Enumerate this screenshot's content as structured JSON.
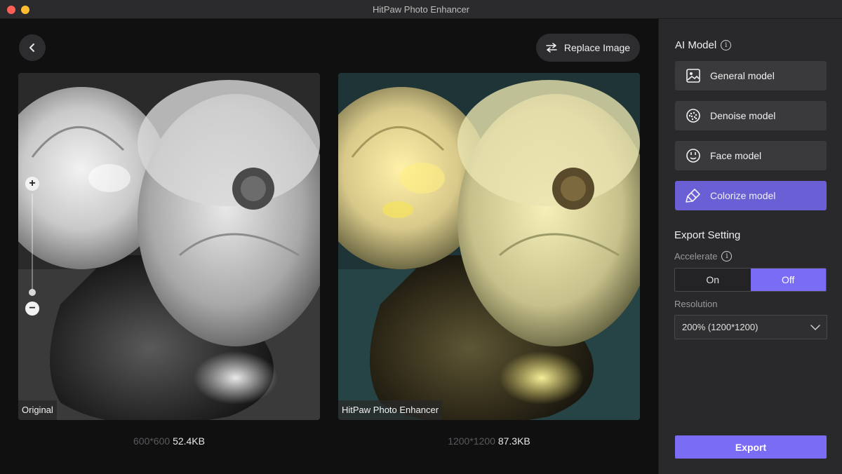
{
  "window": {
    "title": "HitPaw Photo Enhancer"
  },
  "toolbar": {
    "replace_label": "Replace Image"
  },
  "preview": {
    "original": {
      "label": "Original",
      "dimensions": "600*600",
      "size": "52.4KB"
    },
    "enhanced": {
      "label": "HitPaw Photo Enhancer",
      "dimensions": "1200*1200",
      "size": "87.3KB"
    },
    "zoom": {
      "plus": "+",
      "minus": "−"
    }
  },
  "sidebar": {
    "ai_model_title": "AI Model",
    "models": [
      {
        "label": "General model",
        "icon": "image-icon",
        "active": false
      },
      {
        "label": "Denoise model",
        "icon": "denoise-icon",
        "active": false
      },
      {
        "label": "Face model",
        "icon": "face-icon",
        "active": false
      },
      {
        "label": "Colorize model",
        "icon": "colorize-icon",
        "active": true
      }
    ],
    "export_setting_title": "Export Setting",
    "accelerate_label": "Accelerate",
    "accelerate_on": "On",
    "accelerate_off": "Off",
    "accelerate_selected": "Off",
    "resolution_label": "Resolution",
    "resolution_value": "200% (1200*1200)",
    "export_label": "Export"
  },
  "colors": {
    "accent": "#7b6cf6",
    "active_model": "#6b5fd6",
    "sidebar_bg": "#29292b"
  }
}
